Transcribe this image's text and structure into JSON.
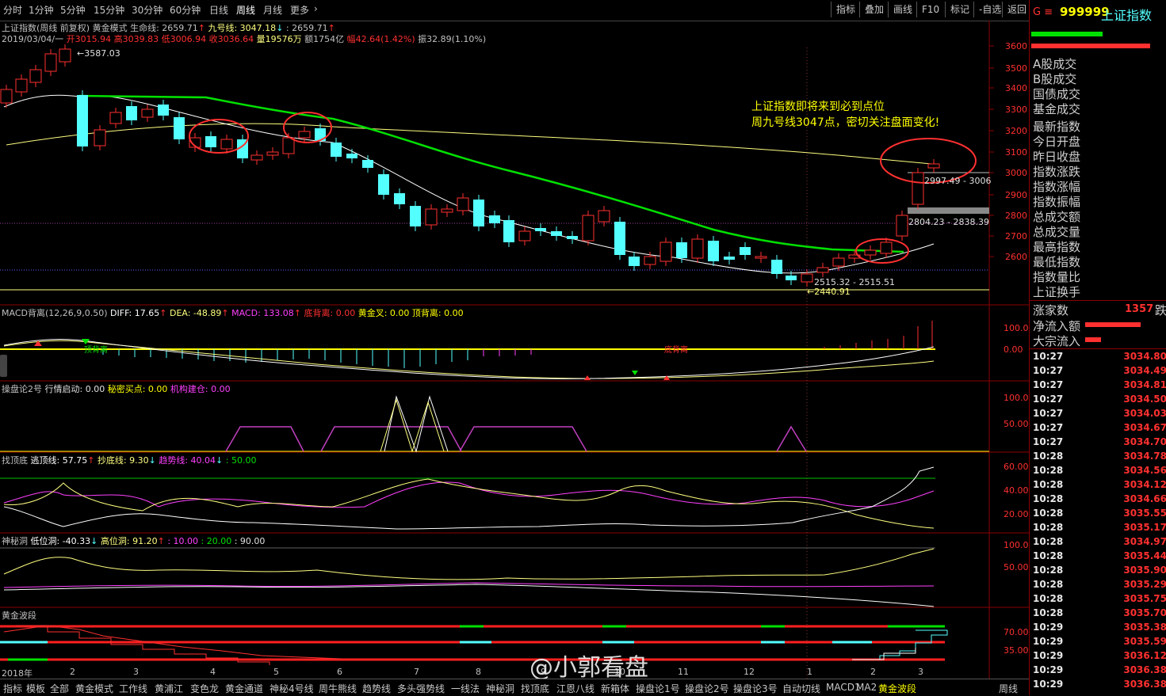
{
  "toolbar": {
    "timeframes": [
      "分时",
      "1分钟",
      "5分钟",
      "15分钟",
      "30分钟",
      "60分钟",
      "日线",
      "周线",
      "月线",
      "更多"
    ],
    "active_timeframe": "周线",
    "right_buttons": [
      "指标",
      "叠加",
      "画线",
      "F10",
      "标记",
      "-自选",
      "返回"
    ]
  },
  "chart_header": {
    "line1": "上证指数(周线 前复权) 黄金模式 生命线: 2659.71",
    "line1b": "九号线: 3047.18",
    "line1c": ": 2659.71",
    "line2_date": "2019/03/04/一",
    "open": "开3015.94",
    "high": "高3039.83",
    "low": "低3006.94",
    "close": "收3036.64",
    "vol": "量19576万",
    "amount": "额1754亿",
    "change": "幅42.64(1.42%)",
    "amplitude": "振32.89(1.10%)"
  },
  "price_axis": [
    "3600",
    "3500",
    "3400",
    "3300",
    "3200",
    "3100",
    "3000",
    "2900",
    "2800",
    "2700",
    "2600"
  ],
  "annotations": {
    "high_label": "3587.03",
    "low_label": "2440.91",
    "range1": "2997.49 - 3006",
    "range2": "2804.23 - 2838.39",
    "range3": "2515.32 - 2515.51",
    "note1": "上证指数即将来到必到点位",
    "note2": "周九号线3047点，密切关注盘面变化!"
  },
  "macd_header": {
    "name": "MACD背离(12,26,9,0.50)",
    "diff": "DIFF: 17.65",
    "dea": "DEA: -48.89",
    "macd": "MACD: 133.08",
    "bottom_div": "底背离: 0.00",
    "golden": "黄金叉: 0.00",
    "top_div": "顶背离: 0.00",
    "axis": [
      "100.0",
      "0.00"
    ],
    "inner_label1": "顶背离",
    "inner_label2": "底背离"
  },
  "cpl_header": {
    "name": "操盘论2号",
    "a": "行情启动: 0.00",
    "b": "秘密买点: 0.00",
    "c": "机构建仓: 0.00",
    "axis": [
      "100.0",
      "50.00"
    ]
  },
  "zdd_header": {
    "name": "找顶底",
    "a": "逃顶线: 57.75",
    "b": "抄底线: 9.30",
    "c": "趋势线: 40.04",
    "d": ": 50.00",
    "axis": [
      "60.00",
      "40.00",
      "20.00"
    ]
  },
  "smd_header": {
    "name": "神秘洞",
    "a": "低位洞: -40.33",
    "b": "高位洞: 91.20",
    "c": ": 10.00",
    "d": ": 20.00",
    "e": ": 90.00",
    "axis": [
      "100.0",
      "50.00"
    ]
  },
  "hjbd_header": {
    "name": "黄金波段",
    "axis": [
      "70.00",
      "35.00"
    ]
  },
  "dates": [
    "2018年",
    "2",
    "3",
    "4",
    "5",
    "6",
    "7",
    "8",
    "9",
    "10",
    "11",
    "12",
    "1",
    "2",
    "3"
  ],
  "right_panel": {
    "code": "999999",
    "name": "上证指数",
    "items": [
      "A股成交",
      "B股成交",
      "国债成交",
      "基金成交",
      "最新指数",
      "今日开盘",
      "昨日收盘",
      "指数涨跌",
      "指数涨幅",
      "指数振幅",
      "总成交额",
      "总成交量",
      "最高指数",
      "最低指数",
      "指数量比",
      "上证换手"
    ],
    "rise_label": "涨家数",
    "rise_value": "1357",
    "rise_suffix": "跌",
    "net_inflow": "净流入额",
    "big_inflow": "大宗流入",
    "ticks": [
      {
        "t": "10:27",
        "p": "3034.80"
      },
      {
        "t": "10:27",
        "p": "3034.49"
      },
      {
        "t": "10:27",
        "p": "3034.81"
      },
      {
        "t": "10:27",
        "p": "3034.50"
      },
      {
        "t": "10:27",
        "p": "3034.03"
      },
      {
        "t": "10:27",
        "p": "3034.67"
      },
      {
        "t": "10:27",
        "p": "3034.70"
      },
      {
        "t": "10:28",
        "p": "3034.78"
      },
      {
        "t": "10:28",
        "p": "3034.56"
      },
      {
        "t": "10:28",
        "p": "3034.12"
      },
      {
        "t": "10:28",
        "p": "3034.66"
      },
      {
        "t": "10:28",
        "p": "3035.55"
      },
      {
        "t": "10:28",
        "p": "3035.17"
      },
      {
        "t": "10:28",
        "p": "3034.97"
      },
      {
        "t": "10:28",
        "p": "3035.44"
      },
      {
        "t": "10:28",
        "p": "3035.90"
      },
      {
        "t": "10:28",
        "p": "3035.29"
      },
      {
        "t": "10:28",
        "p": "3035.75"
      },
      {
        "t": "10:28",
        "p": "3035.70"
      },
      {
        "t": "10:29",
        "p": "3035.38"
      },
      {
        "t": "10:29",
        "p": "3035.59"
      },
      {
        "t": "10:29",
        "p": "3036.12"
      },
      {
        "t": "10:29",
        "p": "3036.38"
      },
      {
        "t": "10:29",
        "p": "3036.38"
      }
    ]
  },
  "bottom_tabs": [
    "指标",
    "模板",
    "全部",
    "黄金模式",
    "工作线",
    "黄浦江",
    "变色龙",
    "黄金通道",
    "神秘4号线",
    "周牛熊线",
    "趋势线",
    "多头强势线",
    "一线法",
    "神秘洞",
    "找顶底",
    "江恩八线",
    "新箱体",
    "操盘论1号",
    "操盘论2号",
    "操盘论3号",
    "自动切线",
    "MACD1",
    "MA2",
    "黄金波段"
  ],
  "active_bottom_tab": "黄金波段",
  "bottom_right": "周线",
  "watermark": "@小郭看盘",
  "colors": {
    "up": "#ff3030",
    "down": "#54ffff",
    "ma_green": "#00e000",
    "ma_yellow": "#ffff80",
    "bg": "#000000"
  }
}
